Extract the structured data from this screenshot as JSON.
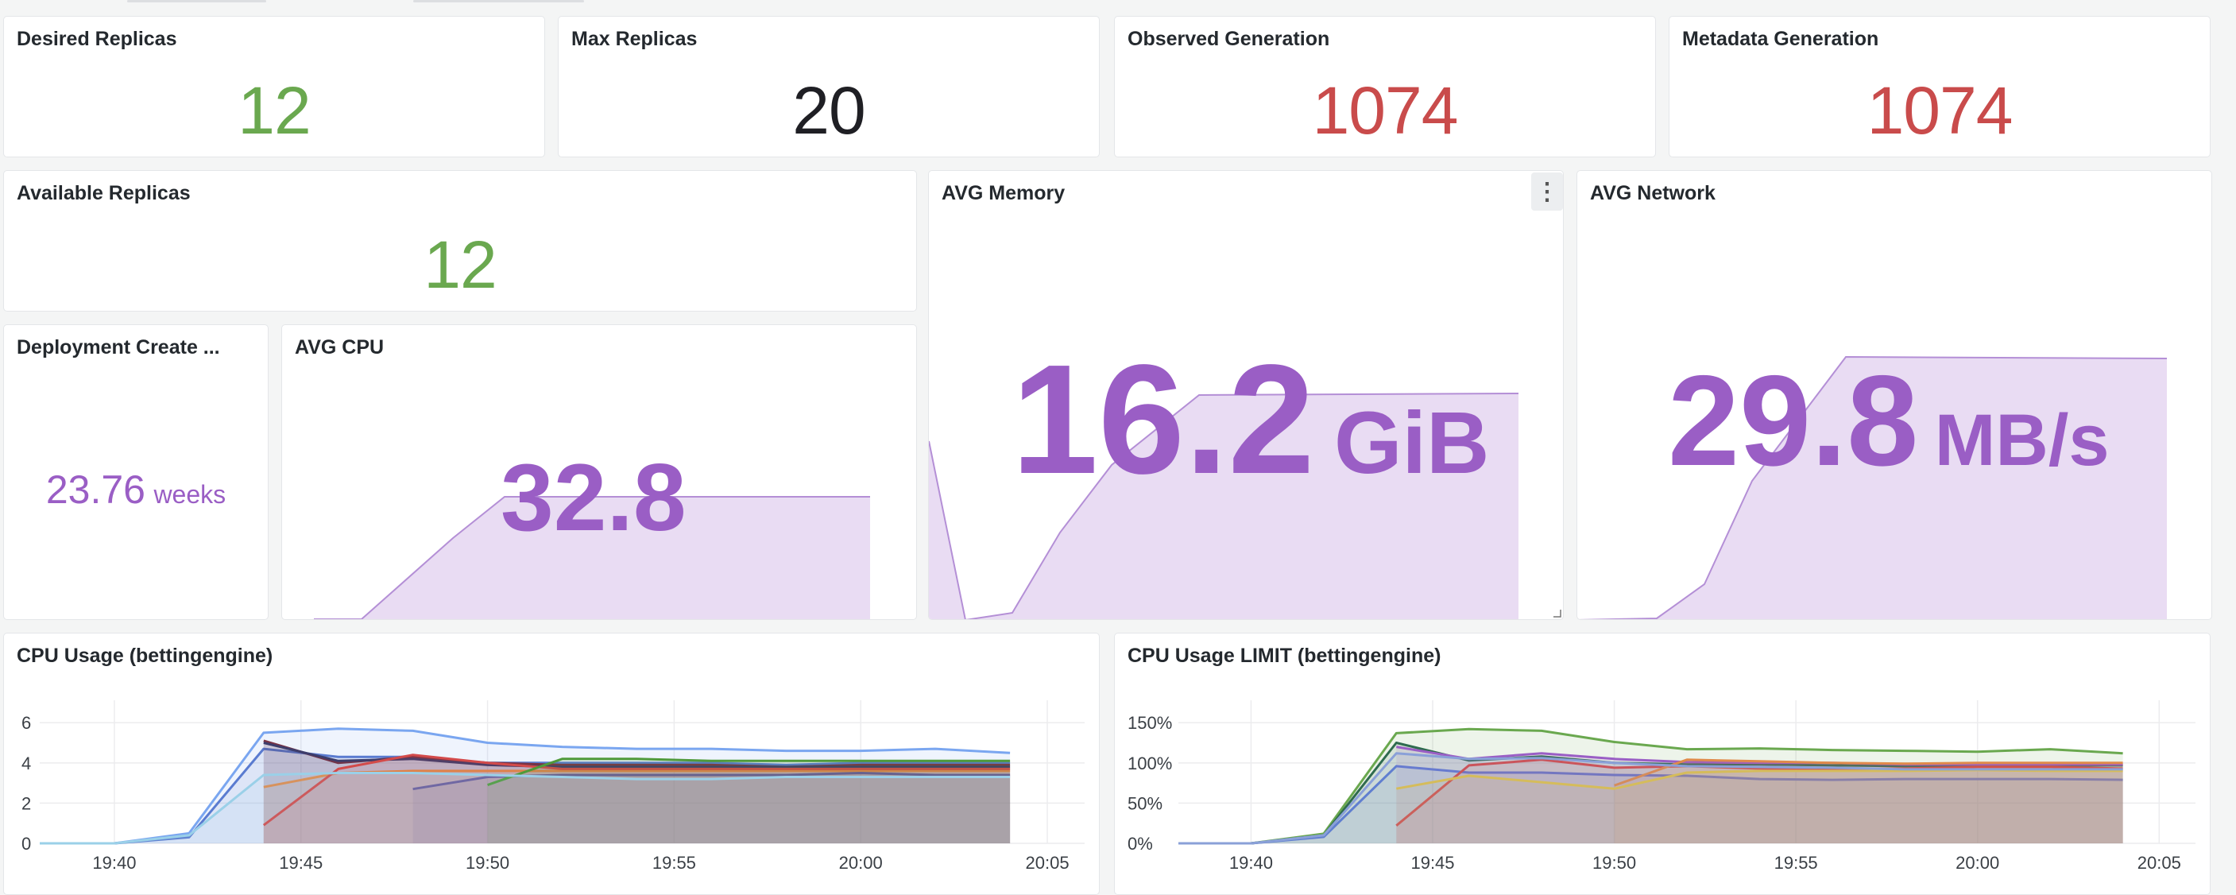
{
  "panels": {
    "desired_replicas": {
      "title": "Desired Replicas",
      "value": "12"
    },
    "max_replicas": {
      "title": "Max Replicas",
      "value": "20"
    },
    "observed_generation": {
      "title": "Observed Generation",
      "value": "1074"
    },
    "metadata_generation": {
      "title": "Metadata Generation",
      "value": "1074"
    },
    "available_replicas": {
      "title": "Available Replicas",
      "value": "12"
    },
    "deployment_create": {
      "title": "Deployment Create ...",
      "value": "23.76",
      "unit": "weeks"
    },
    "avg_cpu": {
      "title": "AVG CPU",
      "value": "32.8"
    },
    "avg_memory": {
      "title": "AVG Memory",
      "value": "16.2",
      "unit": "GiB",
      "menu_icon": "more-vertical-icon"
    },
    "avg_network": {
      "title": "AVG Network",
      "value": "29.8",
      "unit": "MB/s"
    }
  },
  "colors": {
    "green": "#6aa84f",
    "dark": "#1f1f24",
    "red": "#c94b4b",
    "purple": "#9a5ec5",
    "purple_fill": "#e9dcf3"
  },
  "chart_data": [
    {
      "type": "line",
      "title": "CPU Usage (bettingengine)",
      "x_ticks": [
        "19:40",
        "19:45",
        "19:50",
        "19:55",
        "20:00",
        "20:05"
      ],
      "y_ticks": [
        "0",
        "2",
        "4",
        "6"
      ],
      "ylim": [
        0,
        6.8
      ],
      "x": [
        "19:38",
        "19:40",
        "19:42",
        "19:44",
        "19:46",
        "19:48",
        "19:50",
        "19:52",
        "19:54",
        "19:56",
        "19:58",
        "20:00",
        "20:02",
        "20:04"
      ],
      "grid": true,
      "series": [
        {
          "color": "#7aa6f0",
          "values": [
            0,
            0,
            0.5,
            5.5,
            5.7,
            5.6,
            5.0,
            4.8,
            4.7,
            4.7,
            4.6,
            4.6,
            4.7,
            4.5
          ]
        },
        {
          "color": "#5a7bd0",
          "values": [
            0,
            0,
            0.3,
            4.7,
            4.3,
            4.3,
            4.0,
            4.0,
            4.0,
            4.0,
            3.9,
            4.0,
            4.0,
            4.0
          ]
        },
        {
          "color": "#7a3344",
          "values": [
            null,
            null,
            null,
            5.1,
            4.0,
            4.3,
            4.0,
            3.9,
            3.9,
            3.9,
            3.8,
            3.9,
            3.9,
            3.9
          ]
        },
        {
          "color": "#3d3d6b",
          "values": [
            null,
            null,
            null,
            5.0,
            4.1,
            4.2,
            3.9,
            3.8,
            3.8,
            3.8,
            3.8,
            3.8,
            3.8,
            3.8
          ]
        },
        {
          "color": "#e08a4a",
          "values": [
            null,
            null,
            null,
            2.8,
            3.5,
            3.6,
            3.6,
            3.6,
            3.6,
            3.6,
            3.6,
            3.6,
            3.6,
            3.6
          ]
        },
        {
          "color": "#d34a4a",
          "values": [
            null,
            null,
            null,
            0.9,
            3.7,
            4.4,
            4.0,
            3.7,
            3.7,
            3.7,
            3.7,
            3.7,
            3.7,
            3.7
          ]
        },
        {
          "color": "#6a5a9a",
          "values": [
            null,
            null,
            null,
            null,
            null,
            2.7,
            3.3,
            3.4,
            3.4,
            3.4,
            3.4,
            3.5,
            3.4,
            3.4
          ]
        },
        {
          "color": "#4f9a3a",
          "values": [
            null,
            null,
            null,
            null,
            null,
            null,
            2.9,
            4.2,
            4.2,
            4.1,
            4.1,
            4.1,
            4.1,
            4.1
          ]
        },
        {
          "color": "#9ad0e8",
          "values": [
            0,
            0,
            0.4,
            3.4,
            3.5,
            3.5,
            3.4,
            3.3,
            3.2,
            3.2,
            3.3,
            3.3,
            3.3,
            3.3
          ]
        }
      ]
    },
    {
      "type": "line",
      "title": "CPU Usage LIMIT (bettingengine)",
      "x_ticks": [
        "19:40",
        "19:45",
        "19:50",
        "19:55",
        "20:00",
        "20:05"
      ],
      "y_ticks": [
        "0%",
        "50%",
        "100%",
        "150%"
      ],
      "ylim": [
        0,
        170
      ],
      "x": [
        "19:38",
        "19:40",
        "19:42",
        "19:44",
        "19:46",
        "19:48",
        "19:50",
        "19:52",
        "19:54",
        "19:56",
        "19:58",
        "20:00",
        "20:02",
        "20:04"
      ],
      "grid": true,
      "series": [
        {
          "color": "#6aa84f",
          "values": [
            0,
            0,
            12,
            137,
            142,
            140,
            126,
            117,
            118,
            116,
            115,
            114,
            117,
            112
          ]
        },
        {
          "color": "#2f6b4f",
          "values": [
            0,
            0,
            10,
            125,
            103,
            108,
            100,
            98,
            98,
            97,
            96,
            97,
            97,
            97
          ]
        },
        {
          "color": "#5a7bd0",
          "values": [
            0,
            0,
            8,
            96,
            88,
            88,
            85,
            84,
            80,
            79,
            80,
            80,
            80,
            79
          ]
        },
        {
          "color": "#9a5ec5",
          "values": [
            null,
            null,
            null,
            120,
            105,
            112,
            105,
            101,
            100,
            100,
            98,
            98,
            98,
            98
          ]
        },
        {
          "color": "#d34a4a",
          "values": [
            null,
            null,
            null,
            22,
            97,
            104,
            94,
            96,
            93,
            92,
            93,
            95,
            95,
            93
          ]
        },
        {
          "color": "#e08a4a",
          "values": [
            null,
            null,
            null,
            null,
            null,
            null,
            72,
            104,
            102,
            100,
            99,
            100,
            100,
            100
          ]
        },
        {
          "color": "#e0c14a",
          "values": [
            null,
            null,
            null,
            68,
            84,
            null,
            68,
            88,
            90,
            90,
            90,
            91,
            90,
            90
          ]
        },
        {
          "color": "#8aa0d8",
          "values": [
            0,
            0,
            10,
            112,
            105,
            106,
            100,
            96,
            95,
            94,
            92,
            92,
            92,
            92
          ]
        }
      ]
    }
  ]
}
